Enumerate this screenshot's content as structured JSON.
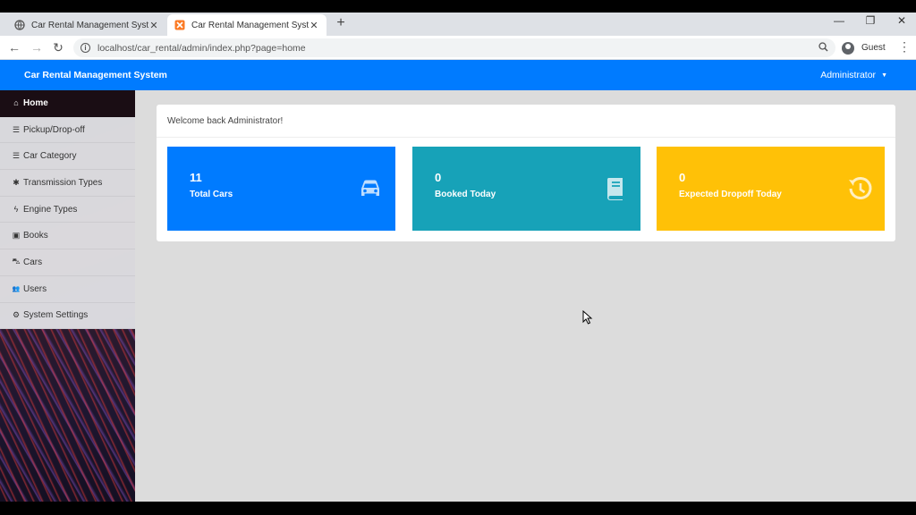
{
  "browser": {
    "tabs": [
      {
        "title": "Car Rental Management System",
        "close": "✕",
        "active": false
      },
      {
        "title": "Car Rental Management System",
        "close": "✕",
        "active": true
      }
    ],
    "new_tab": "+",
    "window_controls": {
      "minimize": "—",
      "restore": "❐",
      "close": "✕"
    },
    "url": "localhost/car_rental/admin/index.php?page=home",
    "profile": "Guest",
    "menu": "⋮"
  },
  "navbar": {
    "brand": "Car Rental Management System",
    "user_menu": "Administrator",
    "color": "#007bff"
  },
  "sidebar": {
    "items": [
      {
        "label": "Home",
        "icon": "home-icon",
        "glyph": "⌂",
        "active": true
      },
      {
        "label": "Pickup/Drop-off",
        "icon": "list-icon",
        "glyph": "☰",
        "active": false
      },
      {
        "label": "Car Category",
        "icon": "list-ul-icon",
        "glyph": "☰",
        "active": false
      },
      {
        "label": "Transmission Types",
        "icon": "cog-icon",
        "glyph": "✱",
        "active": false
      },
      {
        "label": "Engine Types",
        "icon": "bolt-icon",
        "glyph": "ϟ",
        "active": false
      },
      {
        "label": "Books",
        "icon": "book-icon",
        "glyph": "▣",
        "active": false
      },
      {
        "label": "Cars",
        "icon": "car-icon",
        "glyph": "⛍",
        "active": false
      },
      {
        "label": "Users",
        "icon": "users-icon",
        "glyph": "👥",
        "active": false
      },
      {
        "label": "System Settings",
        "icon": "cogs-icon",
        "glyph": "⚙",
        "active": false
      }
    ]
  },
  "main": {
    "welcome": "Welcome back Administrator!",
    "stats": [
      {
        "value": "11",
        "label": "Total Cars",
        "icon": "car-icon",
        "color": "#007bff"
      },
      {
        "value": "0",
        "label": "Booked Today",
        "icon": "book-icon",
        "color": "#17a2b8"
      },
      {
        "value": "0",
        "label": "Expected Dropoff Today",
        "icon": "history-icon",
        "color": "#ffc107"
      }
    ]
  }
}
